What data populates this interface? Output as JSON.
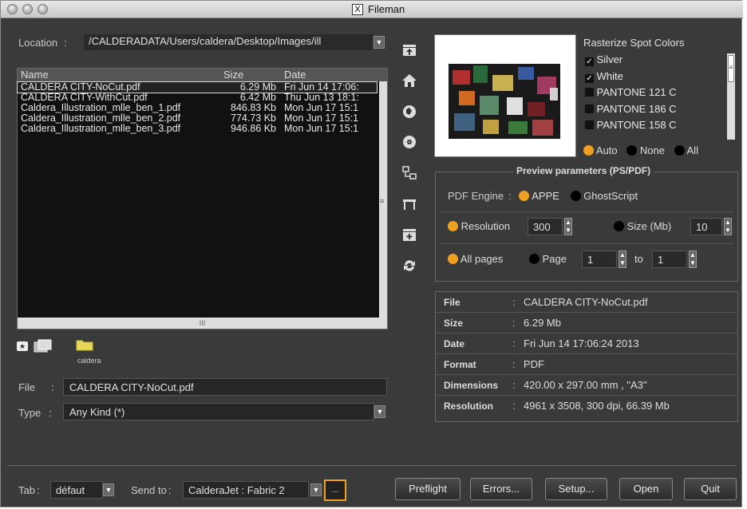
{
  "window": {
    "title": "Fileman"
  },
  "location": {
    "label": "Location",
    "value": "/CALDERADATA/Users/caldera/Desktop/Images/ill"
  },
  "file_list": {
    "columns": [
      "Name",
      "Size",
      "Date"
    ],
    "rows": [
      {
        "name": "CALDERA CITY-NoCut.pdf",
        "size": "6.29 Mb",
        "date": "Fri Jun 14 17:06:"
      },
      {
        "name": "CALDERA CITY-WithCut.pdf",
        "size": "6.42 Mb",
        "date": "Thu Jun 13 18:1:"
      },
      {
        "name": "Caldera_Illustration_mlle_ben_1.pdf",
        "size": "846.83 Kb",
        "date": "Mon Jun 17 15:1"
      },
      {
        "name": "Caldera_Illustration_mlle_ben_2.pdf",
        "size": "774.73 Kb",
        "date": "Mon Jun 17 15:1"
      },
      {
        "name": "Caldera_Illustration_mlle_ben_3.pdf",
        "size": "946.86 Kb",
        "date": "Mon Jun 17 15:1"
      }
    ],
    "hscroll_grip": "III"
  },
  "shortcuts": {
    "folder_label": "caldera"
  },
  "file_field": {
    "label": "File",
    "value": "CALDERA CITY-NoCut.pdf"
  },
  "type_field": {
    "label": "Type",
    "value": "Any Kind (*)"
  },
  "spot_colors": {
    "title": "Rasterize Spot Colors",
    "items": [
      {
        "label": "Silver",
        "checked": true
      },
      {
        "label": "White",
        "checked": true
      },
      {
        "label": "PANTONE 121 C",
        "checked": false
      },
      {
        "label": "PANTONE 186 C",
        "checked": false
      },
      {
        "label": "PANTONE 158 C",
        "checked": false
      }
    ],
    "modes": [
      "Auto",
      "None",
      "All"
    ],
    "selected_mode": "Auto"
  },
  "preview": {
    "title": "Preview parameters (PS/PDF)",
    "engine_label": "PDF Engine",
    "engines": [
      "APPE",
      "GhostScript"
    ],
    "resolution_label": "Resolution",
    "resolution_value": "300",
    "size_label": "Size (Mb)",
    "size_value": "10",
    "all_pages_label": "All pages",
    "page_label": "Page",
    "page_from": "1",
    "to_label": "to",
    "page_to": "1"
  },
  "info": [
    {
      "key": "File",
      "value": "CALDERA CITY-NoCut.pdf"
    },
    {
      "key": "Size",
      "value": "6.29 Mb"
    },
    {
      "key": "Date",
      "value": "Fri Jun 14 17:06:24 2013"
    },
    {
      "key": "Format",
      "value": "PDF"
    },
    {
      "key": "Dimensions",
      "value": "420.00 x 297.00 mm , \"A3\""
    },
    {
      "key": "Resolution",
      "value": "4961 x 3508, 300 dpi, 66.39 Mb"
    }
  ],
  "footer": {
    "tab_label": "Tab",
    "tab_value": "défaut",
    "send_label": "Send to",
    "send_value": "CalderaJet : Fabric 2",
    "more": "...",
    "buttons": {
      "preflight": "Preflight",
      "errors": "Errors...",
      "setup": "Setup...",
      "open": "Open",
      "quit": "Quit"
    }
  }
}
